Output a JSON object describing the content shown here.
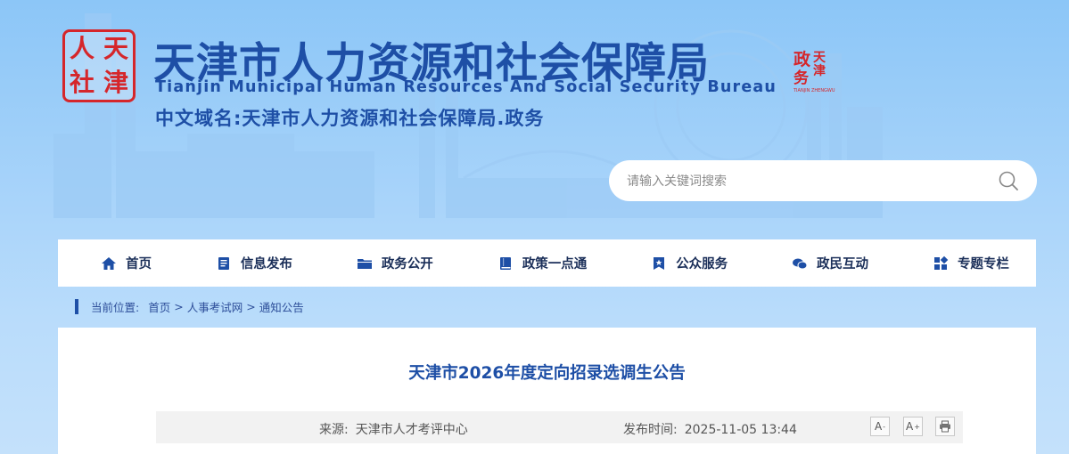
{
  "header": {
    "seal_chars": [
      "人",
      "天",
      "社",
      "津"
    ],
    "title_cn": "天津市人力资源和社会保障局",
    "title_en": "Tianjin Municipal Human Resources And Social Security Bureau",
    "domain_line": "中文域名:天津市人力资源和社会保障局.政务",
    "small_logo": {
      "chars": [
        "政",
        "天",
        "津",
        "务"
      ],
      "caption": "TIANJIN ZHENGWU"
    }
  },
  "search": {
    "placeholder": "请输入关键词搜索",
    "icon": "search-icon"
  },
  "nav": {
    "items": [
      {
        "label": "首页",
        "icon": "home-icon"
      },
      {
        "label": "信息发布",
        "icon": "document-icon"
      },
      {
        "label": "政务公开",
        "icon": "folder-icon"
      },
      {
        "label": "政策一点通",
        "icon": "book-icon"
      },
      {
        "label": "公众服务",
        "icon": "bookmark-star-icon"
      },
      {
        "label": "政民互动",
        "icon": "chat-icon"
      },
      {
        "label": "专题专栏",
        "icon": "grid-icon"
      }
    ]
  },
  "breadcrumb": {
    "label": "当前位置:",
    "items": [
      "首页",
      "人事考试网",
      "通知公告"
    ],
    "separator": ">"
  },
  "article": {
    "title": "天津市2026年度定向招录选调生公告",
    "source_label": "来源:",
    "source": "天津市人才考评中心",
    "time_label": "发布时间:",
    "time": "2025-11-05 13:44",
    "tools": {
      "font_smaller": "A",
      "font_smaller_sup": "-",
      "font_larger": "A",
      "font_larger_sup": "+"
    }
  },
  "colors": {
    "brand_blue": "#1e4fa6",
    "seal_red": "#d5262b",
    "nav_text": "#1b2f59"
  }
}
